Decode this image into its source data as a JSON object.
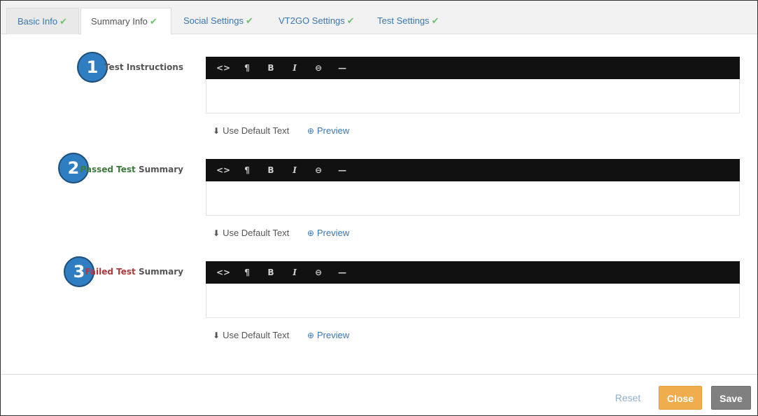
{
  "tabs": [
    {
      "label": "Basic Info",
      "check": "✔"
    },
    {
      "label": "Summary Info",
      "check": "✔"
    },
    {
      "label": "Social Settings",
      "check": "✔"
    },
    {
      "label": "VT2GO Settings",
      "check": "✔"
    },
    {
      "label": "Test Settings",
      "check": "✔"
    }
  ],
  "active_tab": "Summary Info",
  "toolbar": {
    "code": "<>",
    "paragraph": "¶",
    "bold": "B",
    "italic": "I",
    "link": "⊖",
    "rule": "—"
  },
  "sections": [
    {
      "number": "1",
      "label": "Test Instructions"
    },
    {
      "number": "2",
      "label_prefix": "Passed Test",
      "label_suffix": " Summary"
    },
    {
      "number": "3",
      "label_prefix": "Failed Test",
      "label_suffix": " Summary"
    }
  ],
  "actions": {
    "default_text": "Use Default Text",
    "preview": "Preview",
    "download_icon": "⬇",
    "zoom_icon": "⊕"
  },
  "footer": {
    "reset": "Reset",
    "close": "Close",
    "save": "Save"
  },
  "colors": {
    "accent": "#3a76b0",
    "badge": "#2f7ec2",
    "check": "#6cc26c",
    "pass": "#3b7a3b",
    "fail": "#b03a3a",
    "close": "#f0ad4e",
    "save": "#808080"
  }
}
